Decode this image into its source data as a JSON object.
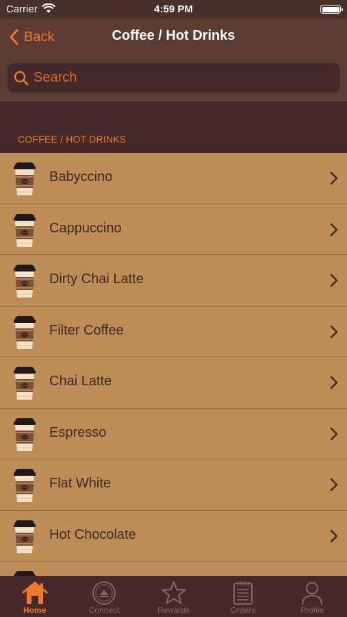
{
  "status_bar": {
    "carrier": "Carrier",
    "time": "4:59 PM"
  },
  "nav": {
    "back_label": "Back",
    "title": "Coffee / Hot Drinks"
  },
  "search": {
    "placeholder": "Search"
  },
  "section": {
    "header": "COFFEE / HOT DRINKS"
  },
  "items": [
    {
      "name": "Babyccino"
    },
    {
      "name": "Cappuccino"
    },
    {
      "name": "Dirty Chai Latte"
    },
    {
      "name": "Filter Coffee"
    },
    {
      "name": "Chai Latte"
    },
    {
      "name": "Espresso"
    },
    {
      "name": "Flat White"
    },
    {
      "name": "Hot Chocolate"
    },
    {
      "name": ""
    }
  ],
  "tabs": [
    {
      "label": "Home",
      "icon": "home-icon",
      "active": true
    },
    {
      "label": "Connect",
      "icon": "connect-icon",
      "active": false
    },
    {
      "label": "Rewards",
      "icon": "star-icon",
      "active": false
    },
    {
      "label": "Orders",
      "icon": "orders-icon",
      "active": false
    },
    {
      "label": "Profile",
      "icon": "profile-icon",
      "active": false
    }
  ],
  "colors": {
    "accent": "#f07a2a",
    "list_bg": "#bd8c57",
    "header_bg": "#5a3c33",
    "dark_bg": "#46292a"
  }
}
